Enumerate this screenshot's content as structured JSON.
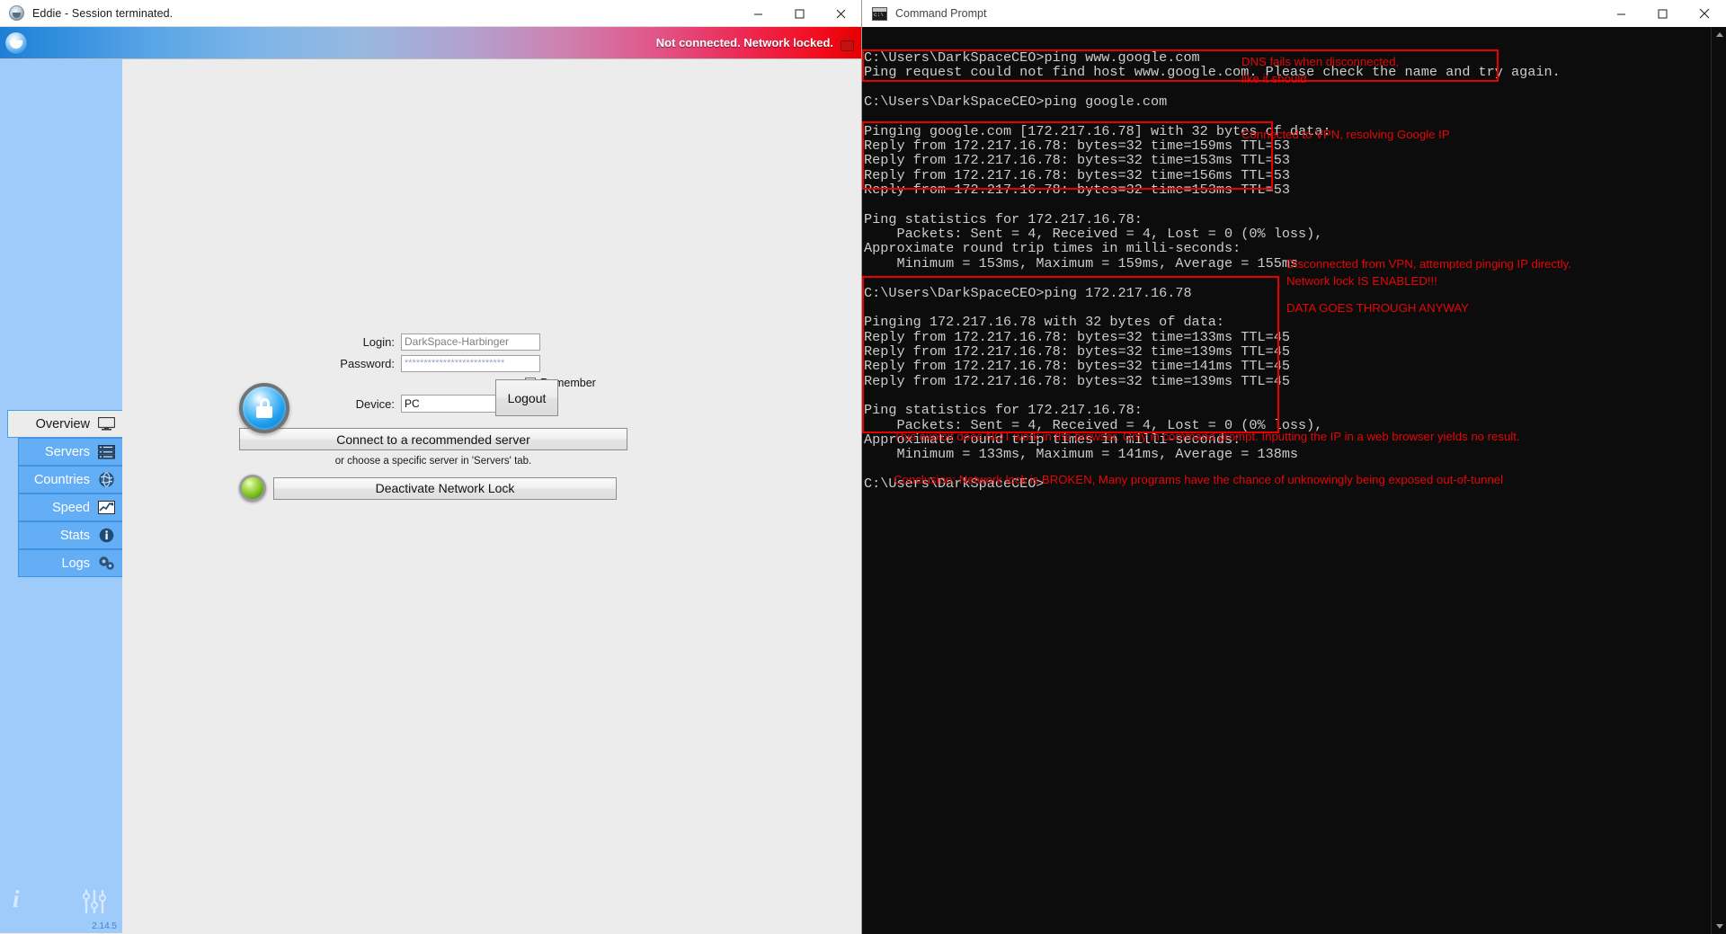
{
  "eddie": {
    "title": "Eddie - Session terminated.",
    "window_controls": {
      "minimize": "–",
      "maximize": "☐",
      "close": "✕"
    },
    "status": {
      "message": "Not connected. Network locked.",
      "lock_icon": "lock-icon",
      "gradient_from": "#1e7fd6",
      "gradient_to": "#e60000"
    },
    "sidebar": {
      "items": [
        {
          "label": "Overview",
          "icon": "monitor-icon",
          "active": true
        },
        {
          "label": "Servers",
          "icon": "servers-icon",
          "active": false
        },
        {
          "label": "Countries",
          "icon": "globe-icon",
          "active": false
        },
        {
          "label": "Speed",
          "icon": "chart-icon",
          "active": false
        },
        {
          "label": "Stats",
          "icon": "info-circle-icon",
          "active": false
        },
        {
          "label": "Logs",
          "icon": "gears-icon",
          "active": false
        }
      ],
      "info_icon": "i",
      "prefs_icon": "sliders-icon",
      "version": "2.14.5",
      "bg_color": "#9fcbfb"
    },
    "login": {
      "lock_badge_icon": "padlock-badge-icon",
      "login_label": "Login:",
      "login_value": "DarkSpace-Harbinger",
      "password_label": "Password:",
      "password_value": "**************************",
      "logout_button": "Logout",
      "remember_label": "Remember",
      "remember_checked": true,
      "device_label": "Device:",
      "device_value": "PC",
      "connect_button": "Connect to a recommended server",
      "hint": "or choose a specific server in 'Servers' tab.",
      "network_lock_button": "Deactivate Network Lock",
      "network_lock_led": "#7cc022"
    }
  },
  "cmd": {
    "title": "Command Prompt",
    "icon": "cmd-icon",
    "window_controls": {
      "minimize": "–",
      "maximize": "☐",
      "close": "✕"
    },
    "prompt": "C:\\Users\\DarkSpaceCEO>",
    "terminal_text": "C:\\Users\\DarkSpaceCEO>ping www.google.com\nPing request could not find host www.google.com. Please check the name and try again.\n\nC:\\Users\\DarkSpaceCEO>ping google.com\n\nPinging google.com [172.217.16.78] with 32 bytes of data:\nReply from 172.217.16.78: bytes=32 time=159ms TTL=53\nReply from 172.217.16.78: bytes=32 time=153ms TTL=53\nReply from 172.217.16.78: bytes=32 time=156ms TTL=53\nReply from 172.217.16.78: bytes=32 time=153ms TTL=53\n\nPing statistics for 172.217.16.78:\n    Packets: Sent = 4, Received = 4, Lost = 0 (0% loss),\nApproximate round trip times in milli-seconds:\n    Minimum = 153ms, Maximum = 159ms, Average = 155ms\n\nC:\\Users\\DarkSpaceCEO>ping 172.217.16.78\n\nPinging 172.217.16.78 with 32 bytes of data:\nReply from 172.217.16.78: bytes=32 time=133ms TTL=45\nReply from 172.217.16.78: bytes=32 time=139ms TTL=45\nReply from 172.217.16.78: bytes=32 time=141ms TTL=45\nReply from 172.217.16.78: bytes=32 time=139ms TTL=45\n\nPing statistics for 172.217.16.78:\n    Packets: Sent = 4, Received = 4, Lost = 0 (0% loss),\nApproximate round trip times in milli-seconds:\n    Minimum = 133ms, Maximum = 141ms, Average = 138ms\n\nC:\\Users\\DarkSpaceCEO>",
    "commands": [
      {
        "command": "ping www.google.com",
        "result": "Ping request could not find host www.google.com. Please check the name and try again."
      },
      {
        "command": "ping google.com",
        "host": "google.com",
        "ip": "172.217.16.78",
        "bytes": 32,
        "replies": [
          {
            "time_ms": 159,
            "ttl": 53
          },
          {
            "time_ms": 153,
            "ttl": 53
          },
          {
            "time_ms": 156,
            "ttl": 53
          },
          {
            "time_ms": 153,
            "ttl": 53
          }
        ],
        "stats": {
          "sent": 4,
          "received": 4,
          "lost": 0,
          "loss_pct": 0,
          "min_ms": 153,
          "max_ms": 159,
          "avg_ms": 155
        }
      },
      {
        "command": "ping 172.217.16.78",
        "host": "172.217.16.78",
        "ip": "172.217.16.78",
        "bytes": 32,
        "replies": [
          {
            "time_ms": 133,
            "ttl": 45
          },
          {
            "time_ms": 139,
            "ttl": 45
          },
          {
            "time_ms": 141,
            "ttl": 45
          },
          {
            "time_ms": 139,
            "ttl": 45
          }
        ],
        "stats": {
          "sent": 4,
          "received": 4,
          "lost": 0,
          "loss_pct": 0,
          "min_ms": 133,
          "max_ms": 141,
          "avg_ms": 138
        }
      }
    ],
    "annotations": [
      {
        "id": "a1",
        "text": "DNS fails when disconnected,\nlike it should"
      },
      {
        "id": "a2",
        "text": "Connected to VPN, resolving Google IP"
      },
      {
        "id": "a3",
        "text": "Disconnected from VPN, attempted pinging IP directly.\nNetwork lock IS ENABLED!!!"
      },
      {
        "id": "a4",
        "text": "DATA GOES THROUGH ANYWAY"
      },
      {
        "id": "a5",
        "text": "This exploit does NOT work in the browser. Only in command prompt. Inputting the IP in a web browser yields no result."
      },
      {
        "id": "a6",
        "text": "Conclusion: Network lock is BROKEN, Many programs have the chance of unknowingly being exposed out-of-tunnel"
      }
    ],
    "annotation_color": "#e60606",
    "highlight_color": "#e60000"
  }
}
